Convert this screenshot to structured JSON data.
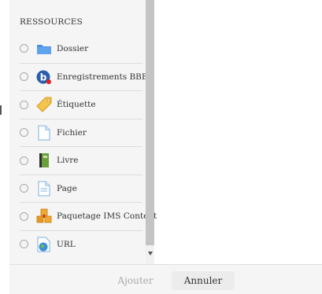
{
  "panel": {
    "heading": "RESSOURCES",
    "items": [
      {
        "label": "Dossier",
        "icon": "folder-icon"
      },
      {
        "label": "Enregistrements BBB",
        "icon": "bigbluebutton-icon"
      },
      {
        "label": "Étiquette",
        "icon": "label-tag-icon"
      },
      {
        "label": "Fichier",
        "icon": "file-icon"
      },
      {
        "label": "Livre",
        "icon": "book-icon"
      },
      {
        "label": "Page",
        "icon": "page-icon"
      },
      {
        "label": "Paquetage IMS Content",
        "icon": "package-icon"
      },
      {
        "label": "URL",
        "icon": "url-globe-icon"
      }
    ]
  },
  "footer": {
    "add_label": "Ajouter",
    "cancel_label": "Annuler"
  },
  "colors": {
    "panel_bg": "#f5f5f5",
    "scroll_thumb": "#c4c4c4",
    "folder": "#4a90e2",
    "bbb": "#2a5ea8",
    "tag": "#e8a020",
    "book": "#6aa03c",
    "package": "#e8a020"
  }
}
